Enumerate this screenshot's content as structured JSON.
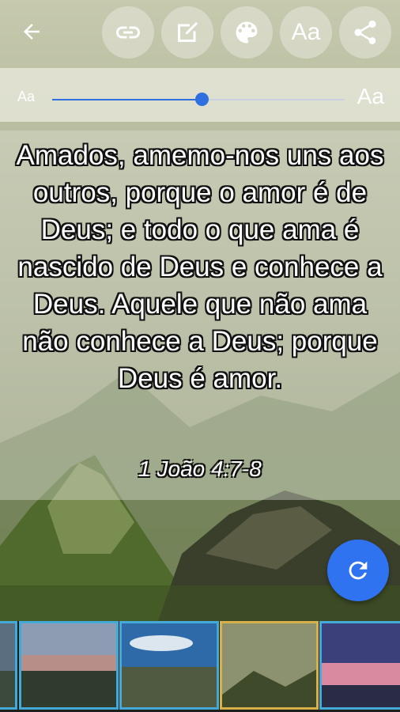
{
  "toolbar": {
    "icons": [
      "arrow-left-icon",
      "link-icon",
      "edit-icon",
      "palette-icon",
      "font-size-icon",
      "share-icon"
    ],
    "font_icon_label": "Aa"
  },
  "size_control": {
    "small_label": "Aa",
    "large_label": "Aa",
    "value_fraction": 0.51
  },
  "verse": {
    "text": "Amados, amemo-nos uns aos outros, porque o amor é de Deus; e todo o que ama é nascido de Deus e conhece a Deus. Aquele que não ama não conhece a Deus; porque Deus é amor.",
    "reference": "1 João 4:7-8"
  },
  "fab": {
    "icon": "refresh-icon",
    "color": "#2f73f0"
  },
  "thumbnails": [
    {
      "name": "thumbnail-0",
      "selected": false
    },
    {
      "name": "thumbnail-1",
      "selected": false
    },
    {
      "name": "thumbnail-2",
      "selected": false
    },
    {
      "name": "thumbnail-3",
      "selected": true
    },
    {
      "name": "thumbnail-4",
      "selected": false
    }
  ],
  "colors": {
    "accent": "#2f6fe0",
    "selected_border": "#d7b04a",
    "thumb_border": "#43a9d6"
  }
}
